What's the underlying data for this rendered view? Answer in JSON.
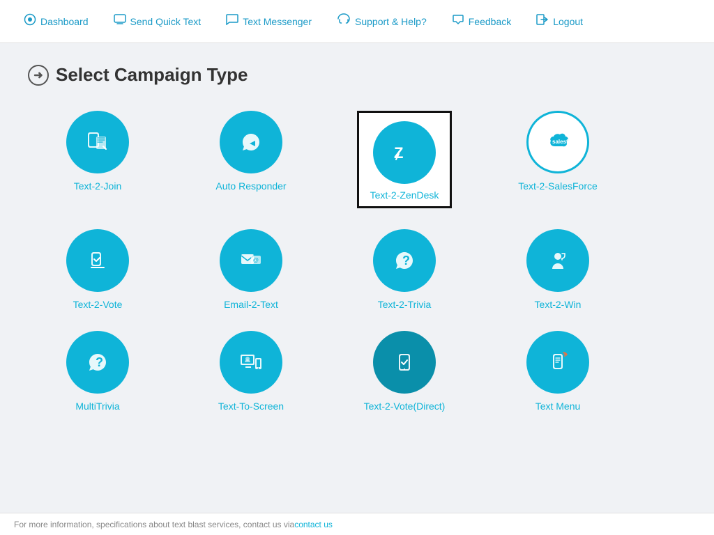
{
  "nav": {
    "items": [
      {
        "id": "dashboard",
        "label": "Dashboard",
        "icon": "⊙"
      },
      {
        "id": "send-quick-text",
        "label": "Send Quick Text",
        "icon": "▤"
      },
      {
        "id": "text-messenger",
        "label": "Text Messenger",
        "icon": "▭"
      },
      {
        "id": "support-help",
        "label": "Support & Help?",
        "icon": "🎧"
      },
      {
        "id": "feedback",
        "label": "Feedback",
        "icon": "↩"
      },
      {
        "id": "logout",
        "label": "Logout",
        "icon": "⬚"
      }
    ]
  },
  "page": {
    "title": "Select Campaign Type"
  },
  "campaigns": [
    {
      "id": "text-2-join",
      "label": "Text-2-Join",
      "selected": false
    },
    {
      "id": "auto-responder",
      "label": "Auto Responder",
      "selected": false
    },
    {
      "id": "text-2-zendesk",
      "label": "Text-2-ZenDesk",
      "selected": true
    },
    {
      "id": "text-2-salesforce",
      "label": "Text-2-SalesForce",
      "selected": false,
      "outline": true
    },
    {
      "id": "text-2-vote",
      "label": "Text-2-Vote",
      "selected": false
    },
    {
      "id": "email-2-text",
      "label": "Email-2-Text",
      "selected": false
    },
    {
      "id": "text-2-trivia",
      "label": "Text-2-Trivia",
      "selected": false
    },
    {
      "id": "text-2-win",
      "label": "Text-2-Win",
      "selected": false
    },
    {
      "id": "multitrivia",
      "label": "MultiTrivia",
      "selected": false
    },
    {
      "id": "text-to-screen",
      "label": "Text-To-Screen",
      "selected": false
    },
    {
      "id": "text-2-vote-direct",
      "label": "Text-2-Vote(Direct)",
      "selected": false
    },
    {
      "id": "text-menu",
      "label": "Text Menu",
      "selected": false
    }
  ],
  "footer": {
    "text": "For more information, specifications about text blast services, contact us via "
  }
}
